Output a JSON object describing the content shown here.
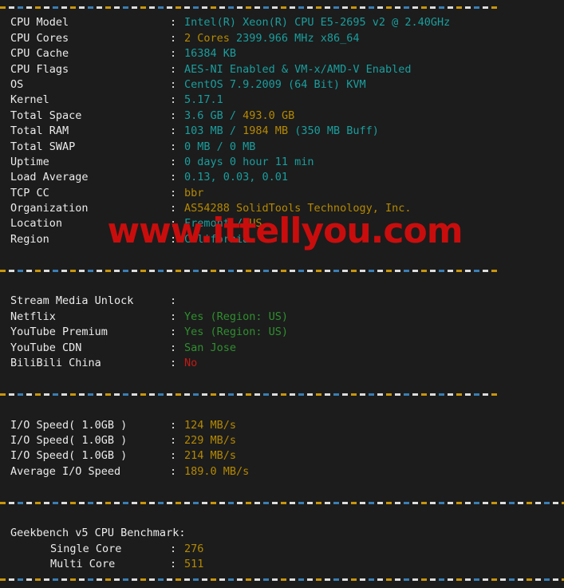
{
  "terminal": {
    "separator_top": "------------------------------------------------------------",
    "separator_full": "--------------------------------------------------------------------------",
    "sections": [
      {
        "name": "system-info",
        "rows": [
          {
            "label": "CPU Model",
            "colon": ":",
            "parts": [
              {
                "text": "Intel(R) Xeon(R) CPU E5-2695 v2 @ 2.40GHz",
                "color": "cyan"
              }
            ]
          },
          {
            "label": "CPU Cores",
            "colon": ":",
            "parts": [
              {
                "text": "2 Cores",
                "color": "gold"
              },
              {
                "text": " 2399.966 MHz x86_64",
                "color": "cyan"
              }
            ]
          },
          {
            "label": "CPU Cache",
            "colon": ":",
            "parts": [
              {
                "text": "16384 KB",
                "color": "cyan"
              }
            ]
          },
          {
            "label": "CPU Flags",
            "colon": ":",
            "parts": [
              {
                "text": "AES-NI Enabled & VM-x/AMD-V Enabled",
                "color": "cyan"
              }
            ]
          },
          {
            "label": "OS",
            "colon": ":",
            "parts": [
              {
                "text": "CentOS 7.9.2009 (64 Bit) KVM",
                "color": "cyan"
              }
            ]
          },
          {
            "label": "Kernel",
            "colon": ":",
            "parts": [
              {
                "text": "5.17.1",
                "color": "cyan"
              }
            ]
          },
          {
            "label": "Total Space",
            "colon": ":",
            "parts": [
              {
                "text": "3.6 GB",
                "color": "cyan"
              },
              {
                "text": " / ",
                "color": "cyan"
              },
              {
                "text": "493.0 GB",
                "color": "gold"
              }
            ]
          },
          {
            "label": "Total RAM",
            "colon": ":",
            "parts": [
              {
                "text": "103 MB",
                "color": "cyan"
              },
              {
                "text": " / ",
                "color": "cyan"
              },
              {
                "text": "1984 MB",
                "color": "gold"
              },
              {
                "text": " (350 MB Buff)",
                "color": "cyan"
              }
            ]
          },
          {
            "label": "Total SWAP",
            "colon": ":",
            "parts": [
              {
                "text": "0 MB / 0 MB",
                "color": "cyan"
              }
            ]
          },
          {
            "label": "Uptime",
            "colon": ":",
            "parts": [
              {
                "text": "0 days 0 hour 11 min",
                "color": "cyan"
              }
            ]
          },
          {
            "label": "Load Average",
            "colon": ":",
            "parts": [
              {
                "text": "0.13, 0.03, 0.01",
                "color": "cyan"
              }
            ]
          },
          {
            "label": "TCP CC",
            "colon": ":",
            "parts": [
              {
                "text": "bbr",
                "color": "gold"
              }
            ]
          },
          {
            "label": "Organization",
            "colon": ":",
            "parts": [
              {
                "text": "AS54288 SolidTools Technology, Inc.",
                "color": "gold"
              }
            ]
          },
          {
            "label": "Location",
            "colon": ":",
            "parts": [
              {
                "text": "Fremont",
                "color": "cyan"
              },
              {
                "text": " / ",
                "color": "cyan"
              },
              {
                "text": "US",
                "color": "gold"
              }
            ]
          },
          {
            "label": "Region",
            "colon": ":",
            "parts": [
              {
                "text": "California",
                "color": "cyan"
              }
            ]
          }
        ]
      },
      {
        "name": "stream-media-unlock",
        "rows": [
          {
            "label": "Stream Media Unlock",
            "colon": ":",
            "parts": []
          },
          {
            "label": "Netflix",
            "colon": ":",
            "parts": [
              {
                "text": "Yes (Region: US)",
                "color": "green"
              }
            ]
          },
          {
            "label": "YouTube Premium",
            "colon": ":",
            "parts": [
              {
                "text": "Yes (Region: US)",
                "color": "green"
              }
            ]
          },
          {
            "label": "YouTube CDN",
            "colon": ":",
            "parts": [
              {
                "text": "San Jose",
                "color": "green"
              }
            ]
          },
          {
            "label": "BiliBili China",
            "colon": ":",
            "parts": [
              {
                "text": "No",
                "color": "red"
              }
            ]
          }
        ]
      },
      {
        "name": "io-speed",
        "rows": [
          {
            "label": "I/O Speed( 1.0GB )",
            "colon": ":",
            "parts": [
              {
                "text": "124 MB/s",
                "color": "gold"
              }
            ]
          },
          {
            "label": "I/O Speed( 1.0GB )",
            "colon": ":",
            "parts": [
              {
                "text": "229 MB/s",
                "color": "gold"
              }
            ]
          },
          {
            "label": "I/O Speed( 1.0GB )",
            "colon": ":",
            "parts": [
              {
                "text": "214 MB/s",
                "color": "gold"
              }
            ]
          },
          {
            "label": "Average I/O Speed",
            "colon": ":",
            "parts": [
              {
                "text": "189.0 MB/s",
                "color": "gold"
              }
            ]
          }
        ]
      },
      {
        "name": "geekbench",
        "heading": "Geekbench v5 CPU Benchmark:",
        "rows": [
          {
            "label": "Single Core",
            "indent": true,
            "colon": ":",
            "parts": [
              {
                "text": "276",
                "color": "gold"
              }
            ]
          },
          {
            "label": "Multi Core",
            "indent": true,
            "colon": ":",
            "parts": [
              {
                "text": "511",
                "color": "gold"
              }
            ]
          }
        ]
      }
    ]
  },
  "watermark": {
    "text": "www.ittellyou.com",
    "color": "#c90d0d"
  },
  "colors": {
    "background": "#1c1c1c",
    "label": "#ebebeb",
    "cyan": "#1a9e9e",
    "gold": "#b58900",
    "green": "#2f8f2f",
    "red": "#c21a16"
  }
}
